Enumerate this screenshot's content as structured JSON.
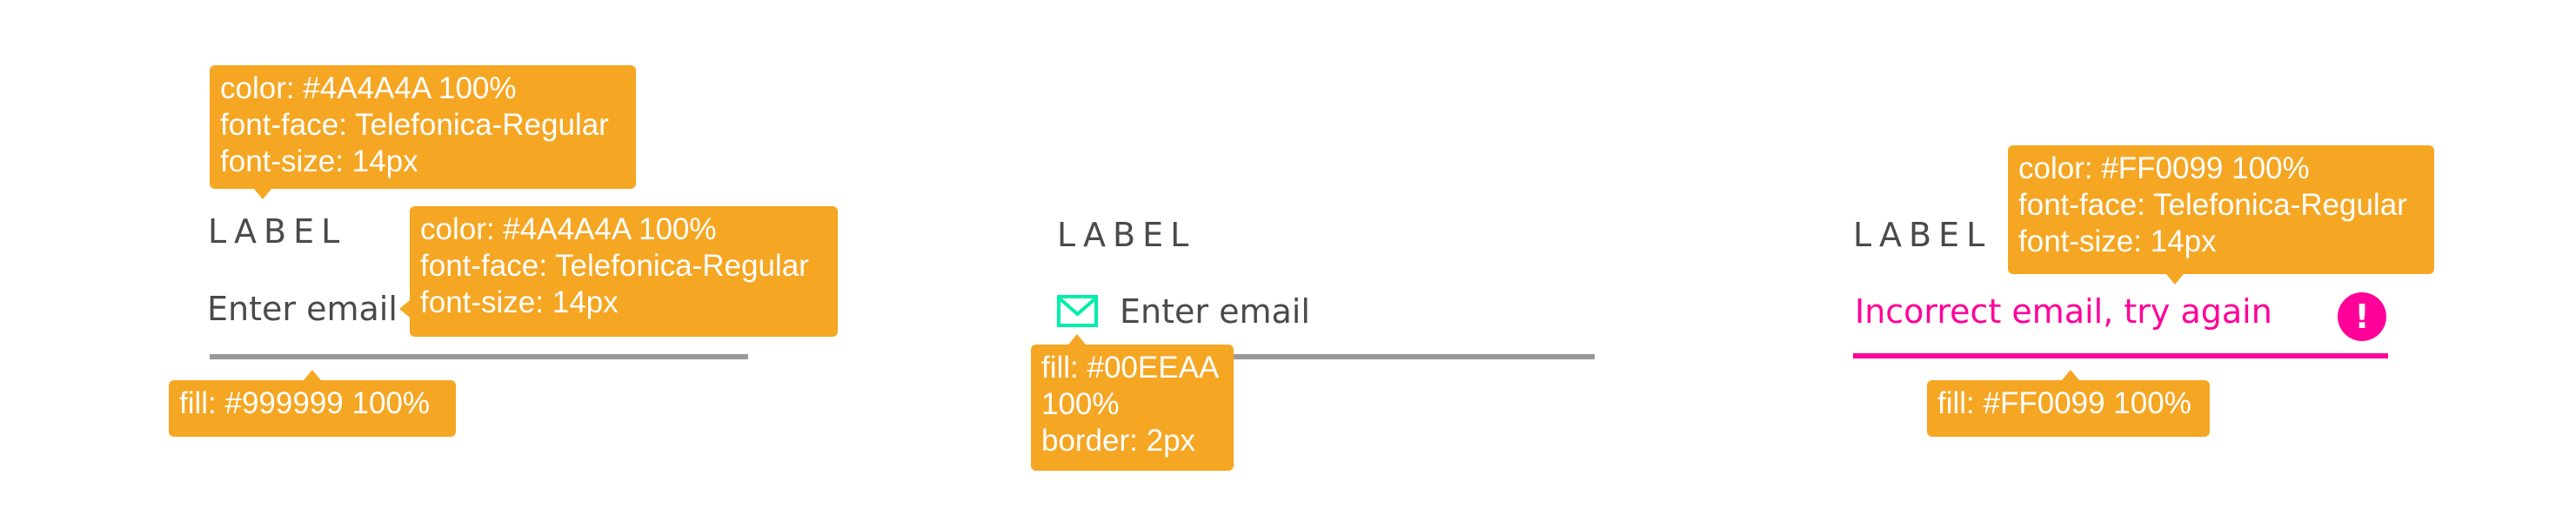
{
  "colors": {
    "text": "#4A4A4A",
    "line_default": "#999999",
    "line_focus": "#999999",
    "accent_icon": "#00EEAA",
    "error": "#FF0099",
    "tooltip_bg": "#F5A623",
    "tooltip_text": "#FFFFFF"
  },
  "states": {
    "default": {
      "label": "LABEL",
      "placeholder": "Enter email",
      "tooltip_label": [
        "color: #4A4A4A 100%",
        "font-face: Telefonica-Regular",
        "font-size: 14px"
      ],
      "tooltip_placeholder": [
        "color: #4A4A4A 100%",
        "font-face: Telefonica-Regular",
        "font-size: 14px"
      ],
      "tooltip_line": [
        "fill: #999999 100%"
      ]
    },
    "with_icon": {
      "label": "LABEL",
      "placeholder": "Enter email",
      "icon": "envelope-icon",
      "tooltip_icon": [
        "fill: #00EEAA",
        "100%",
        "border: 2px"
      ]
    },
    "error": {
      "label": "LABEL",
      "message": "Incorrect email, try again",
      "icon": "exclamation-icon",
      "icon_glyph": "!",
      "tooltip_message": [
        "color: #FF0099 100%",
        "font-face: Telefonica-Regular",
        "font-size: 14px"
      ],
      "tooltip_line": [
        "fill: #FF0099 100%"
      ]
    }
  }
}
